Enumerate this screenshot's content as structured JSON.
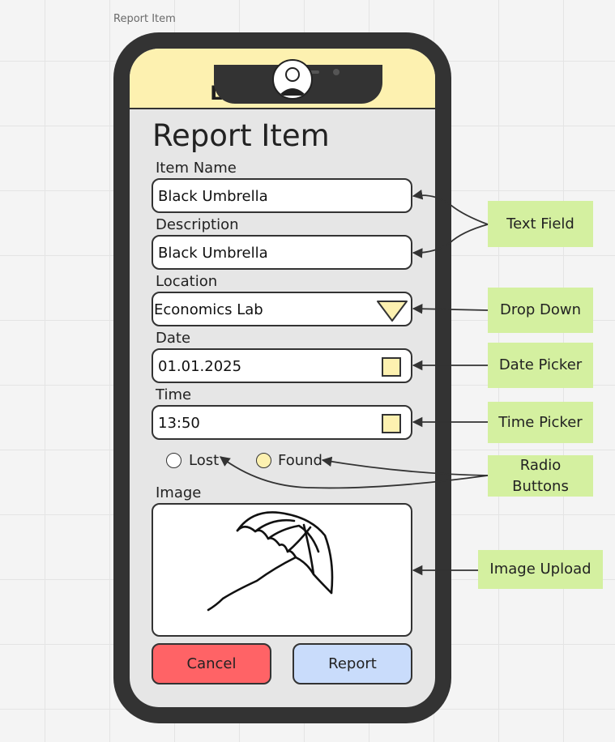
{
  "frame_label": "Report Item",
  "app": {
    "title": "Lost & Found"
  },
  "page": {
    "title": "Report Item"
  },
  "form": {
    "item_name": {
      "label": "Item Name",
      "value": "Black Umbrella"
    },
    "description": {
      "label": "Description",
      "value": "Black Umbrella"
    },
    "location": {
      "label": "Location",
      "value": "Economics Lab"
    },
    "date": {
      "label": "Date",
      "value": "01.01.2025"
    },
    "time": {
      "label": "Time",
      "value": "13:50"
    },
    "radio": {
      "lost_label": "Lost",
      "found_label": "Found",
      "selected": "Found"
    },
    "image": {
      "label": "Image"
    }
  },
  "buttons": {
    "cancel": "Cancel",
    "report": "Report"
  },
  "annotations": {
    "text_field": "Text Field",
    "drop_down": "Drop Down",
    "date_picker": "Date Picker",
    "time_picker": "Time Picker",
    "radio_buttons": "Radio Buttons",
    "image_upload": "Image Upload"
  },
  "colors": {
    "app_bar": "#fdf1b0",
    "cancel_button": "#ff6366",
    "report_button": "#c9dcfb",
    "annotation_note": "#d4f0a0",
    "phone_frame": "#333333"
  }
}
